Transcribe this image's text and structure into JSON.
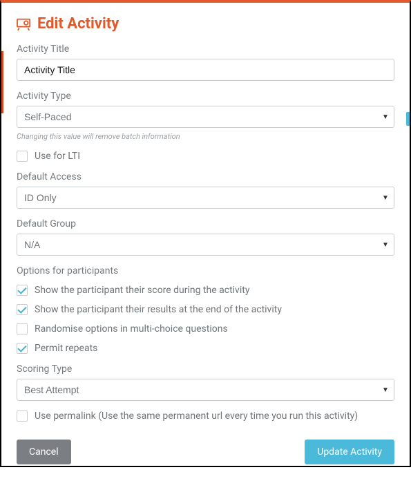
{
  "header": {
    "title": "Edit Activity"
  },
  "fields": {
    "activity_title_label": "Activity Title",
    "activity_title_value": "Activity Title",
    "activity_type_label": "Activity Type",
    "activity_type_value": "Self-Paced",
    "activity_type_helper": "Changing this value will remove batch information",
    "use_for_lti_label": "Use for LTI",
    "default_access_label": "Default Access",
    "default_access_value": "ID Only",
    "default_group_label": "Default Group",
    "default_group_value": "N/A",
    "options_label": "Options for participants",
    "opt_show_score": "Show the participant their score during the activity",
    "opt_show_results": "Show the participant their results at the end of the activity",
    "opt_randomise": "Randomise options in multi-choice questions",
    "opt_permit_repeats": "Permit repeats",
    "scoring_type_label": "Scoring Type",
    "scoring_type_value": "Best Attempt",
    "use_permalink_label": "Use permalink (Use the same permanent url every time you run this activity)"
  },
  "buttons": {
    "cancel": "Cancel",
    "update": "Update Activity"
  }
}
